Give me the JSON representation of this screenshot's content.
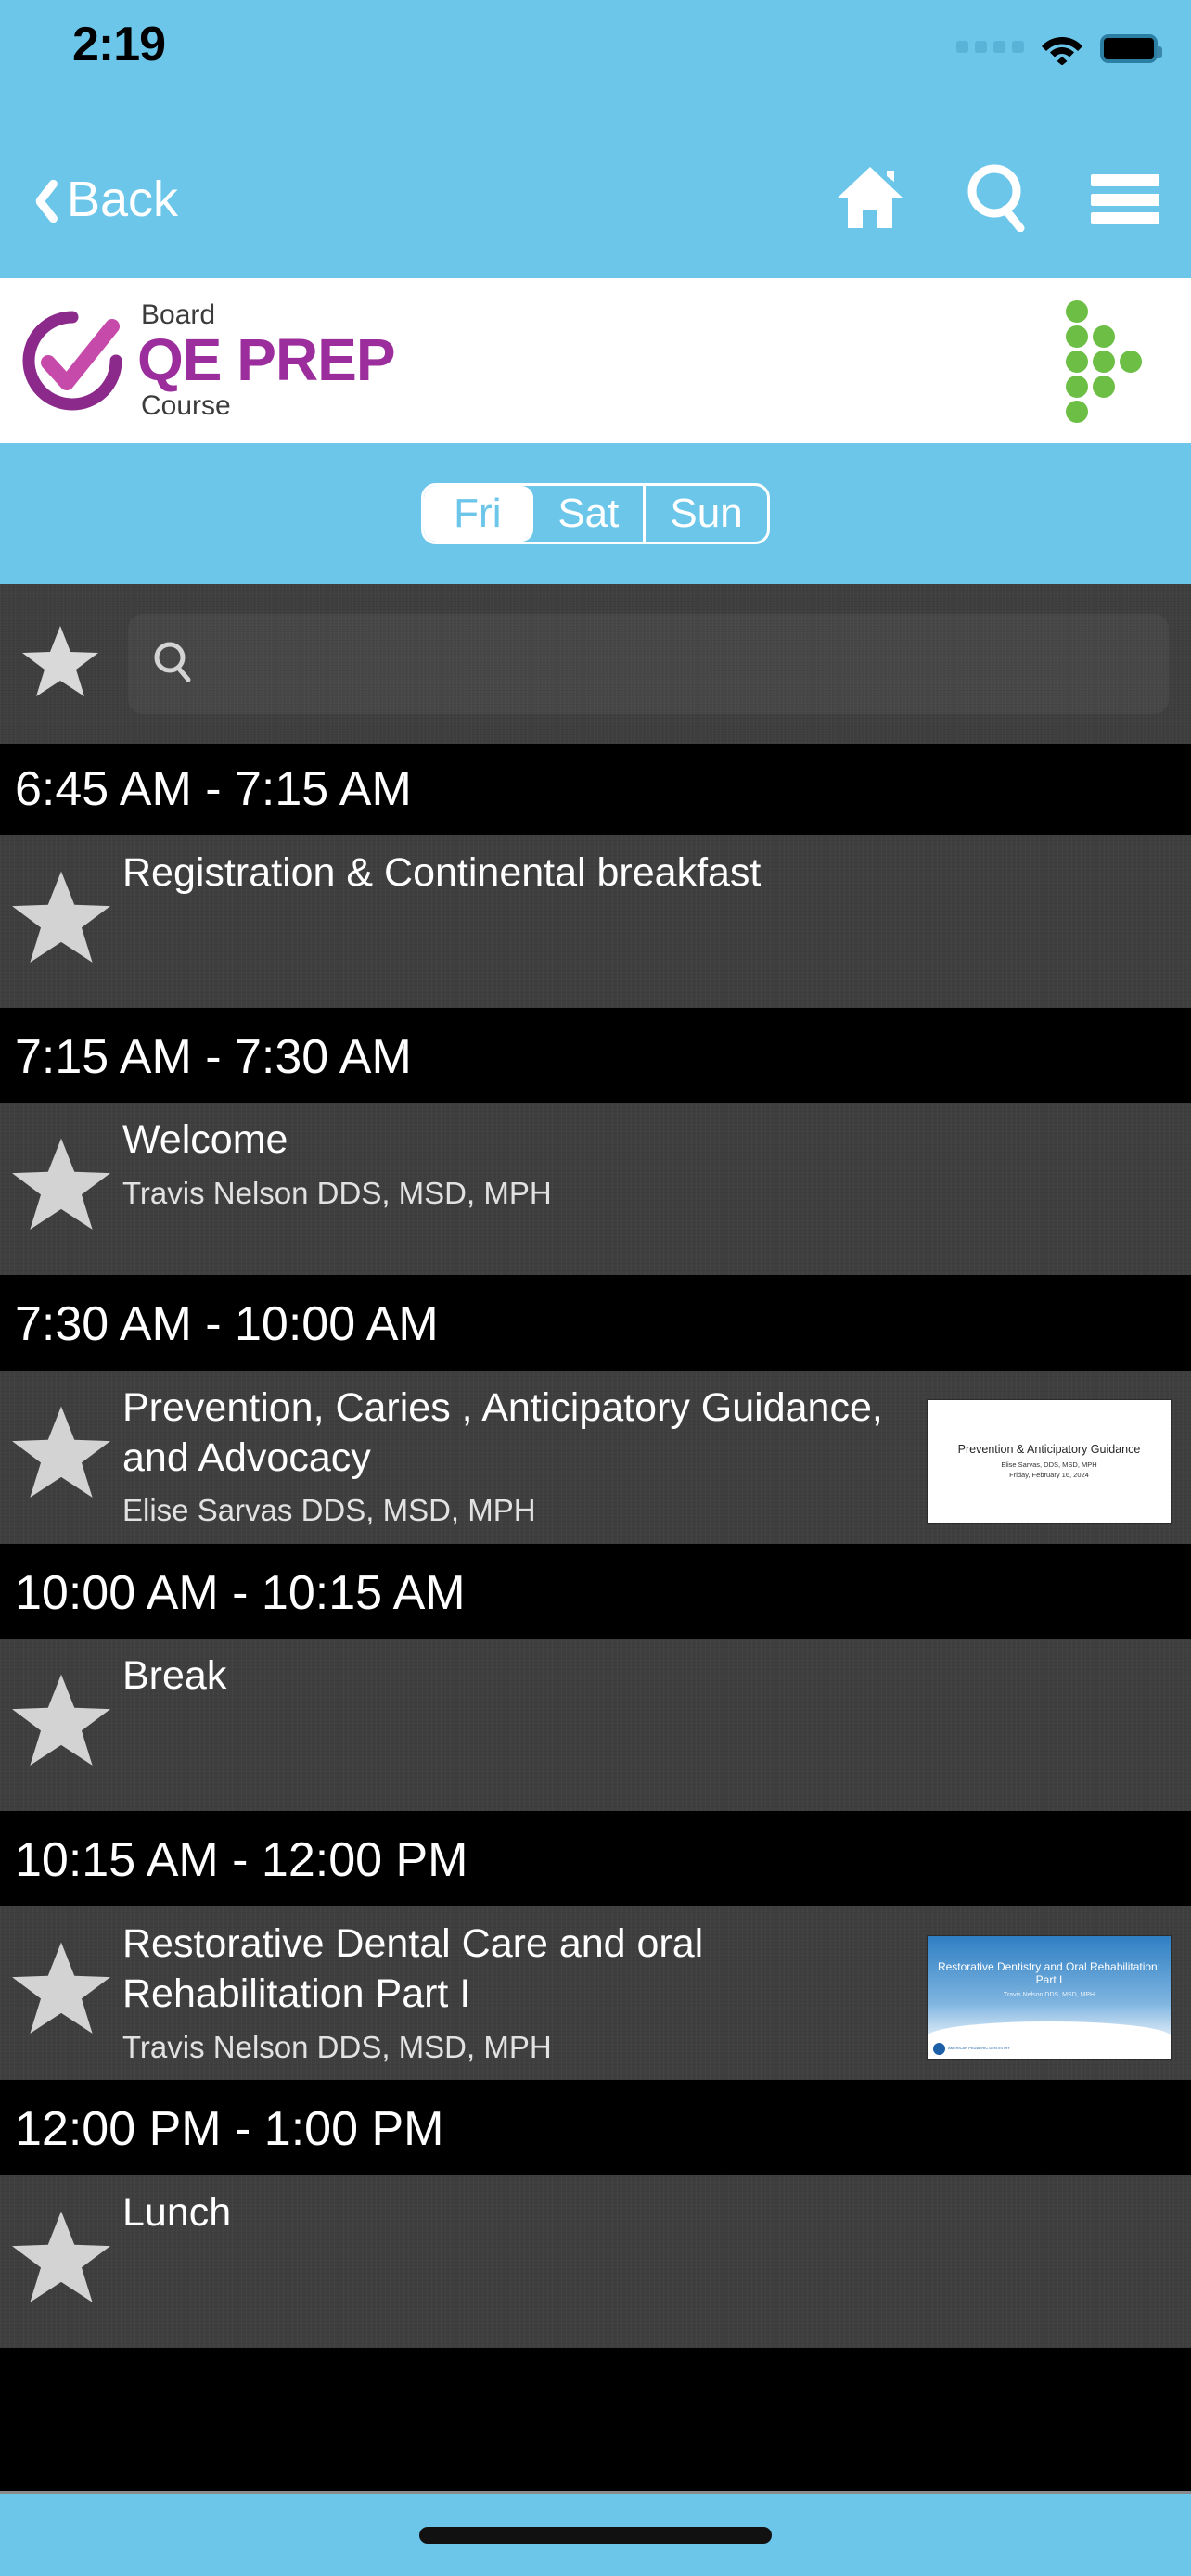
{
  "status_bar": {
    "time": "2:19",
    "signal_icon": "signal-dots-icon",
    "wifi_icon": "wifi-icon",
    "battery_icon": "battery-full-icon"
  },
  "nav_bar": {
    "back_label": "Back",
    "home_icon": "home-icon",
    "search_icon": "search-icon",
    "menu_icon": "hamburger-menu-icon"
  },
  "brand": {
    "line_top": "Board",
    "line_main": "QE PREP",
    "line_bottom": "Course",
    "mark_icon": "check-circle-icon",
    "accent_color": "#9c2d9c",
    "dots_color": "#6cbe45",
    "header_color": "#6cc6ea"
  },
  "day_tabs": {
    "selected": "Fri",
    "items": [
      {
        "label": "Fri",
        "active": true
      },
      {
        "label": "Sat",
        "active": false
      },
      {
        "label": "Sun",
        "active": false
      }
    ]
  },
  "search": {
    "favorite_icon": "star-icon",
    "magnifier_icon": "search-icon",
    "value": "",
    "placeholder": ""
  },
  "schedule": [
    {
      "time": "6:45 AM - 7:15 AM",
      "title": "Registration & Continental breakfast",
      "speaker": "",
      "star_icon": "star-icon",
      "thumbnail": null
    },
    {
      "time": "7:15 AM - 7:30 AM",
      "title": "Welcome",
      "speaker": "Travis Nelson DDS, MSD, MPH",
      "star_icon": "star-icon",
      "thumbnail": null
    },
    {
      "time": "7:30 AM - 10:00 AM",
      "title": "Prevention, Caries , Anticipatory Guidance, and Advocacy",
      "speaker": "Elise Sarvas DDS, MSD, MPH",
      "star_icon": "star-icon",
      "thumbnail": {
        "style": "plain",
        "title": "Prevention & Anticipatory Guidance",
        "sub1": "Elise Sarvas, DDS, MSD, MPH",
        "sub2": "Friday, February 16, 2024"
      }
    },
    {
      "time": "10:00 AM - 10:15 AM",
      "title": "Break",
      "speaker": "",
      "star_icon": "star-icon",
      "thumbnail": null
    },
    {
      "time": "10:15 AM - 12:00 PM",
      "title": "Restorative Dental Care and oral Rehabilitation Part I",
      "speaker": "Travis Nelson DDS, MSD, MPH",
      "star_icon": "star-icon",
      "thumbnail": {
        "style": "blue",
        "title": "Restorative Dentistry and Oral Rehabilitation: Part I",
        "sub1": "Travis Nelson DDS, MSD, MPH",
        "sub2": ""
      }
    },
    {
      "time": "12:00 PM - 1:00 PM",
      "title": "Lunch",
      "speaker": "",
      "star_icon": "star-icon",
      "thumbnail": null
    }
  ],
  "home_indicator": "home-indicator"
}
